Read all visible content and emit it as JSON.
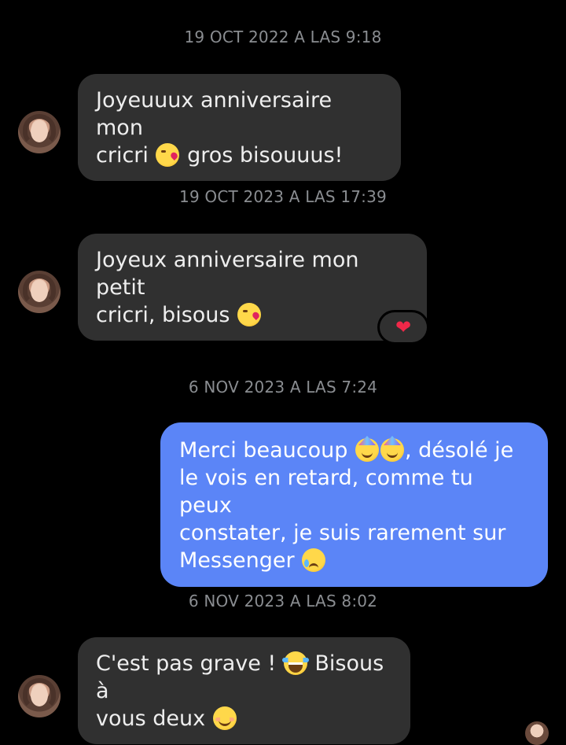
{
  "messages": {
    "ts1": "19 OCT 2022 A LAS 9:18",
    "m1_a": "Joyeuuux anniversaire mon",
    "m1_b": "cricri ",
    "m1_c": " gros bisouuus!",
    "ts2": "19 OCT 2023 A LAS 17:39",
    "m2_a": "Joyeux anniversaire mon petit",
    "m2_b": "cricri, bisous ",
    "reaction_icon": "❤",
    "ts3": "6 NOV 2023 A LAS 7:24",
    "m3_a": "Merci beaucoup ",
    "m3_b": ", désolé je",
    "m3_c": "le vois en retard, comme tu peux",
    "m3_d": "constater, je suis rarement sur",
    "m3_e": "Messenger ",
    "ts4": "6 NOV 2023 A LAS 8:02",
    "m4_a": "C'est pas grave ! ",
    "m4_b": " Bisous à",
    "m4_c": "vous deux "
  },
  "icons": {
    "avatar": "contact-avatar",
    "kiss": "face-blowing-kiss-icon",
    "party": "partying-face-icon",
    "sad": "sad-tear-face-icon",
    "laugh": "tears-of-joy-icon",
    "smile": "smiling-face-icon",
    "heart": "heart-reaction-icon"
  },
  "colors": {
    "background": "#000000",
    "incoming_bubble": "#303030",
    "outgoing_bubble": "#5b85f7",
    "timestamp": "#8a8d91",
    "heart": "#f02849"
  }
}
